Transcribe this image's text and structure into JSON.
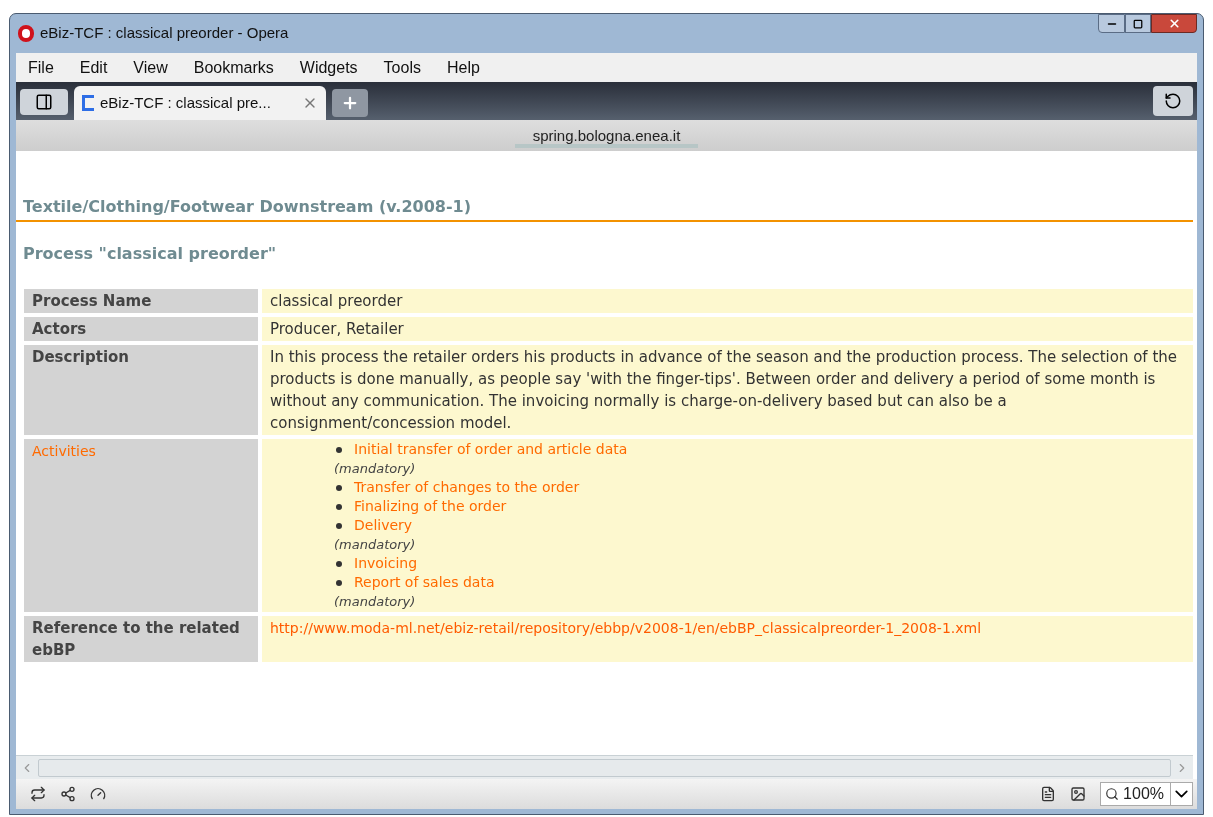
{
  "window": {
    "title": "eBiz-TCF : classical preorder - Opera"
  },
  "menu": [
    {
      "label": "File"
    },
    {
      "label": "Edit"
    },
    {
      "label": "View"
    },
    {
      "label": "Bookmarks"
    },
    {
      "label": "Widgets"
    },
    {
      "label": "Tools"
    },
    {
      "label": "Help"
    }
  ],
  "tabs": [
    {
      "label": "eBiz-TCF : classical pre...",
      "selected": true
    }
  ],
  "address": "spring.bologna.enea.it",
  "page": {
    "site_title": "Textile/Clothing/Footwear Downstream (v.2008-1)",
    "heading": "Process \"classical preorder\"",
    "rows": [
      {
        "kind": "text",
        "label": "Process Name",
        "value": "classical preorder"
      },
      {
        "kind": "text",
        "label": "Actors",
        "value": "Producer, Retailer"
      },
      {
        "kind": "text",
        "label": "Description",
        "value": "In this process the retailer orders his products in advance of the season and the production process. The selection of the products is done manually, as people say 'with the finger-tips'. Between order and delivery a period of some month is without any communication. The invoicing normally is charge-on-delivery based but can also be a consignment/concession model."
      },
      {
        "kind": "activities",
        "label": "Activities",
        "items": [
          {
            "name": "Initial transfer of order and article data",
            "note": "(mandatory)"
          },
          {
            "name": "Transfer of changes to the order"
          },
          {
            "name": "Finalizing of the order"
          },
          {
            "name": "Delivery",
            "note": "(mandatory)"
          },
          {
            "name": "Invoicing"
          },
          {
            "name": "Report of sales data",
            "note": "(mandatory)"
          }
        ]
      },
      {
        "kind": "link",
        "label": "Reference to the related ebBP",
        "value": "http://www.moda-ml.net/ebiz-retail/repository/ebbp/v2008-1/en/ebBP_classicalpreorder-1_2008-1.xml"
      }
    ]
  },
  "status_bar": {
    "zoom": "100%"
  }
}
